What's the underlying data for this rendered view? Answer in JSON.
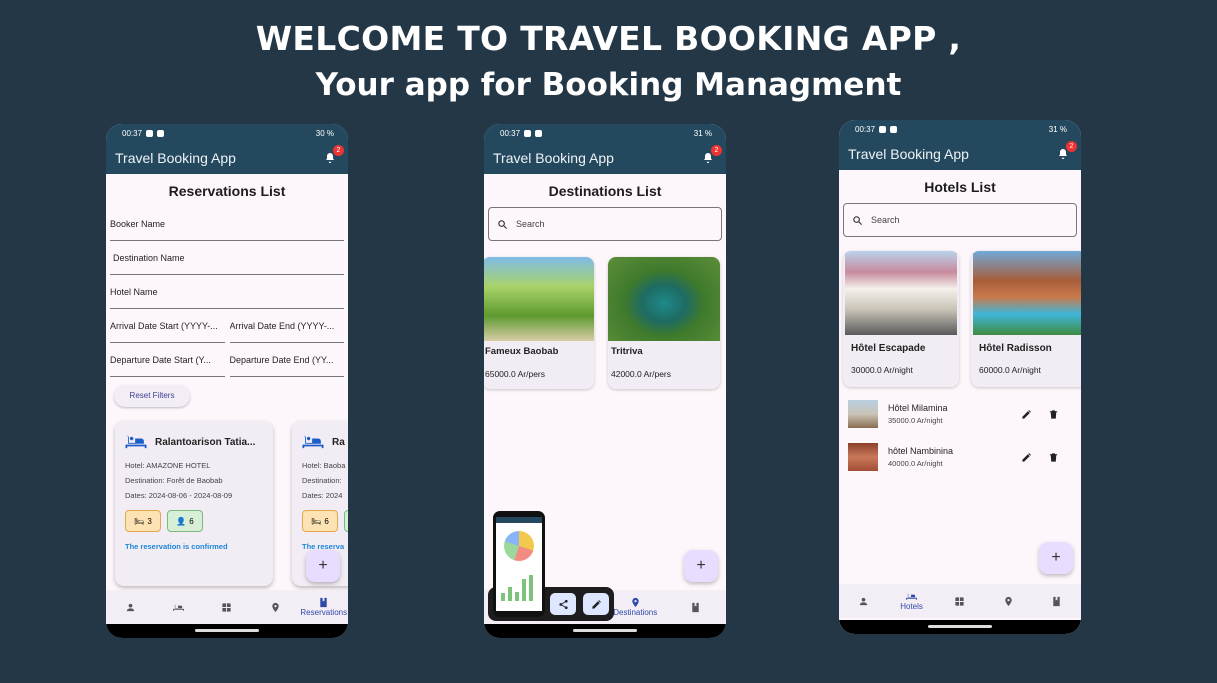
{
  "hero": {
    "line1": "WELCOME TO TRAVEL BOOKING APP ,",
    "line2": "Your app for Booking Managment"
  },
  "app": {
    "title": "Travel Booking App",
    "notif_count": "2"
  },
  "phone1": {
    "status_time": "00:37",
    "battery": "30 %",
    "page_title": "Reservations List",
    "fields": {
      "booker": "Booker Name",
      "destination": "Destination Name",
      "hotel": "Hotel Name",
      "arrival_start": "Arrival Date Start (YYYY-...",
      "arrival_end": "Arrival Date End (YYYY-...",
      "departure_start": "Departure Date Start (Y...",
      "departure_end": "Departure Date End (YY..."
    },
    "reset_label": "Reset Filters",
    "cards": [
      {
        "name": "Ralantoarison Tatia...",
        "hotel": "Hotel: AMAZONE HOTEL",
        "destination": "Destination: Forêt de Baobab",
        "dates": "Dates: 2024-08-06 - 2024-08-09",
        "beds": "3",
        "people": "6",
        "status": "The reservation is confirmed"
      },
      {
        "name": "Ra",
        "hotel": "Hotel: Baoba",
        "destination": "Destination:",
        "dates": "Dates: 2024",
        "beds": "6",
        "status": "The reserva"
      }
    ],
    "nav": [
      "",
      "",
      "",
      "",
      "Reservations"
    ]
  },
  "phone2": {
    "status_time": "00:37",
    "battery": "31 %",
    "page_title": "Destinations List",
    "search_placeholder": "Search",
    "destinations": [
      {
        "name": "Fameux Baobab",
        "price": "65000.0 Ar/pers"
      },
      {
        "name": "Tritriva",
        "price": "42000.0 Ar/pers"
      }
    ],
    "nav_active": "Destinations"
  },
  "phone3": {
    "status_time": "00:37",
    "battery": "31 %",
    "page_title": "Hotels List",
    "search_placeholder": "Search",
    "featured": [
      {
        "name": "Hôtel Escapade",
        "price": "30000.0 Ar/night"
      },
      {
        "name": "Hôtel Radisson",
        "price": "60000.0 Ar/night"
      }
    ],
    "list": [
      {
        "name": "Hôtel Milamina",
        "price": "35000.0 Ar/night"
      },
      {
        "name": "hôtel Nambinina",
        "price": "40000.0 Ar/night"
      }
    ],
    "nav_active": "Hotels"
  },
  "colors": {
    "background": "#243746",
    "appbar": "#24495e",
    "accent": "#2f4aa8",
    "confirmed": "#1c87d8"
  }
}
